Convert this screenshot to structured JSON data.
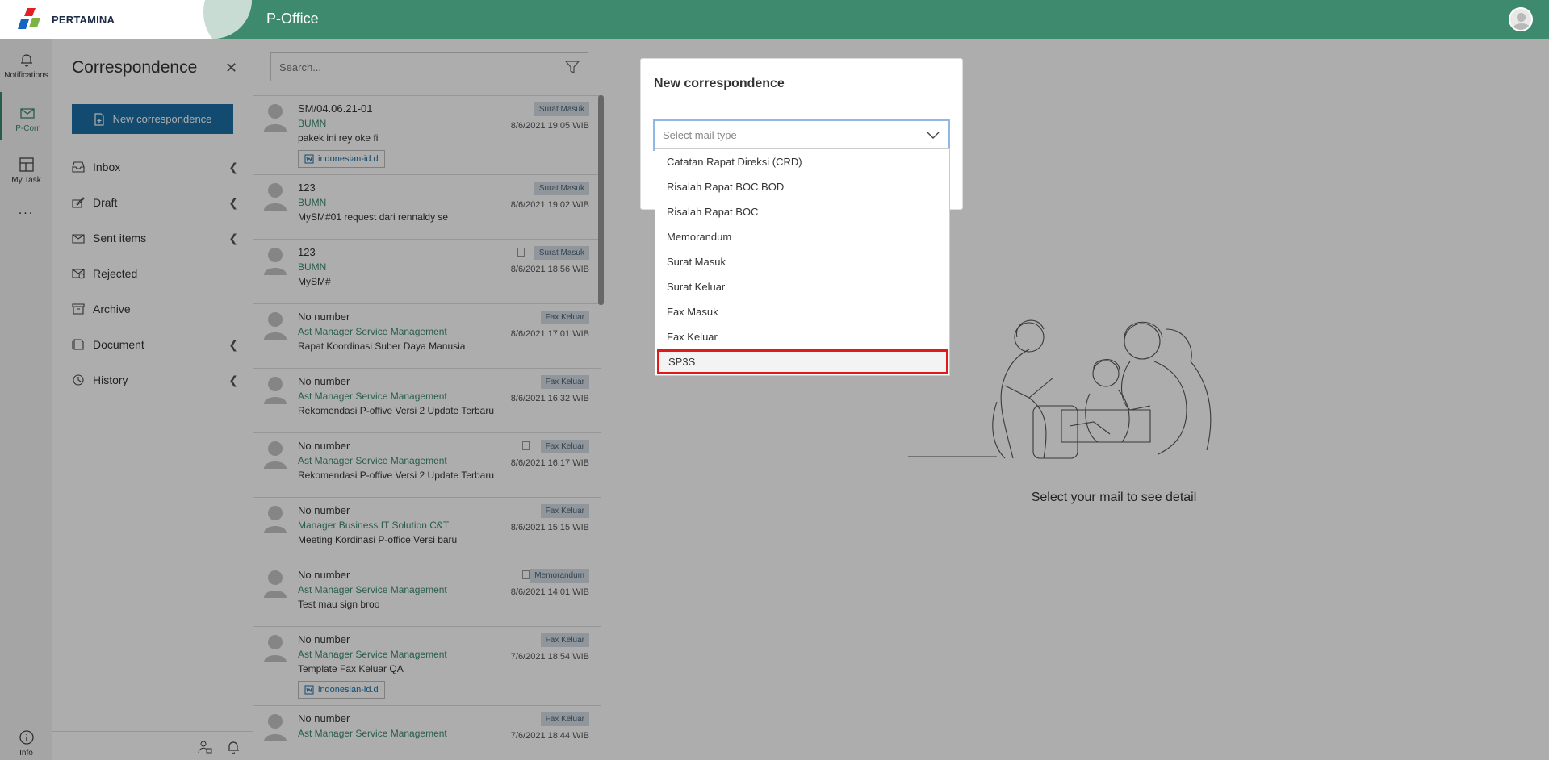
{
  "brand": {
    "name": "PERTAMINA",
    "app_title": "P-Office"
  },
  "rail": {
    "notifications": "Notifications",
    "pcorr": "P-Corr",
    "mytask": "My Task",
    "more": "...",
    "info": "Info"
  },
  "sidebar": {
    "title": "Correspondence",
    "new_button": "New correspondence",
    "items": [
      {
        "label": "Inbox",
        "chevron": true
      },
      {
        "label": "Draft",
        "chevron": true
      },
      {
        "label": "Sent items",
        "chevron": true
      },
      {
        "label": "Rejected",
        "chevron": false
      },
      {
        "label": "Archive",
        "chevron": false
      },
      {
        "label": "Document",
        "chevron": true
      },
      {
        "label": "History",
        "chevron": true
      }
    ]
  },
  "search": {
    "placeholder": "Search..."
  },
  "mails": [
    {
      "number": "SM/04.06.21-01",
      "from": "BUMN",
      "subject": "pakek ini rey oke fi",
      "tag": "Surat Masuk",
      "date": "8/6/2021 19:05 WIB",
      "attachment": "indonesian-id.d",
      "clip": false
    },
    {
      "number": "123",
      "from": "BUMN",
      "subject": "MySM#01 request dari rennaldy se",
      "tag": "Surat Masuk",
      "date": "8/6/2021 19:02 WIB",
      "attachment": "",
      "clip": false
    },
    {
      "number": "123",
      "from": "BUMN",
      "subject": "MySM#",
      "tag": "Surat Masuk",
      "date": "8/6/2021 18:56 WIB",
      "attachment": "",
      "clip": true
    },
    {
      "number": "No number",
      "from": "Ast Manager Service Management",
      "subject": "Rapat Koordinasi Suber Daya Manusia",
      "tag": "Fax Keluar",
      "date": "8/6/2021 17:01 WIB",
      "attachment": "",
      "clip": false
    },
    {
      "number": "No number",
      "from": "Ast Manager Service Management",
      "subject": "Rekomendasi P-offive Versi 2 Update Terbaru",
      "tag": "Fax Keluar",
      "date": "8/6/2021 16:32 WIB",
      "attachment": "",
      "clip": false
    },
    {
      "number": "No number",
      "from": "Ast Manager Service Management",
      "subject": "Rekomendasi P-offive Versi 2 Update Terbaru",
      "tag": "Fax Keluar",
      "date": "8/6/2021 16:17 WIB",
      "attachment": "",
      "clip": true
    },
    {
      "number": "No number",
      "from": "Manager Business IT Solution C&T",
      "subject": "Meeting Kordinasi P-office Versi baru",
      "tag": "Fax Keluar",
      "date": "8/6/2021 15:15 WIB",
      "attachment": "",
      "clip": false
    },
    {
      "number": "No number",
      "from": "Ast Manager Service Management",
      "subject": "Test mau sign broo",
      "tag": "Memorandum",
      "date": "8/6/2021 14:01 WIB",
      "attachment": "",
      "clip": true
    },
    {
      "number": "No number",
      "from": "Ast Manager Service Management",
      "subject": "Template Fax Keluar QA",
      "tag": "Fax Keluar",
      "date": "7/6/2021 18:54 WIB",
      "attachment": "indonesian-id.d",
      "clip": false
    },
    {
      "number": "No number",
      "from": "Ast Manager Service Management",
      "subject": "",
      "tag": "Fax Keluar",
      "date": "7/6/2021 18:44 WIB",
      "attachment": "",
      "clip": false
    }
  ],
  "detail": {
    "empty_text": "Select your mail to see detail"
  },
  "modal": {
    "title": "New correspondence",
    "select_placeholder": "Select mail type",
    "options": [
      "Catatan Rapat Direksi (CRD)",
      "Risalah Rapat BOC BOD",
      "Risalah Rapat BOC",
      "Memorandum",
      "Surat Masuk",
      "Surat Keluar",
      "Fax Masuk",
      "Fax Keluar",
      "SP3S"
    ],
    "highlighted_option": "SP3S"
  },
  "colors": {
    "brand_green": "#3d8a6f",
    "primary_blue": "#1c6ea4",
    "highlight_red": "#e01919"
  }
}
